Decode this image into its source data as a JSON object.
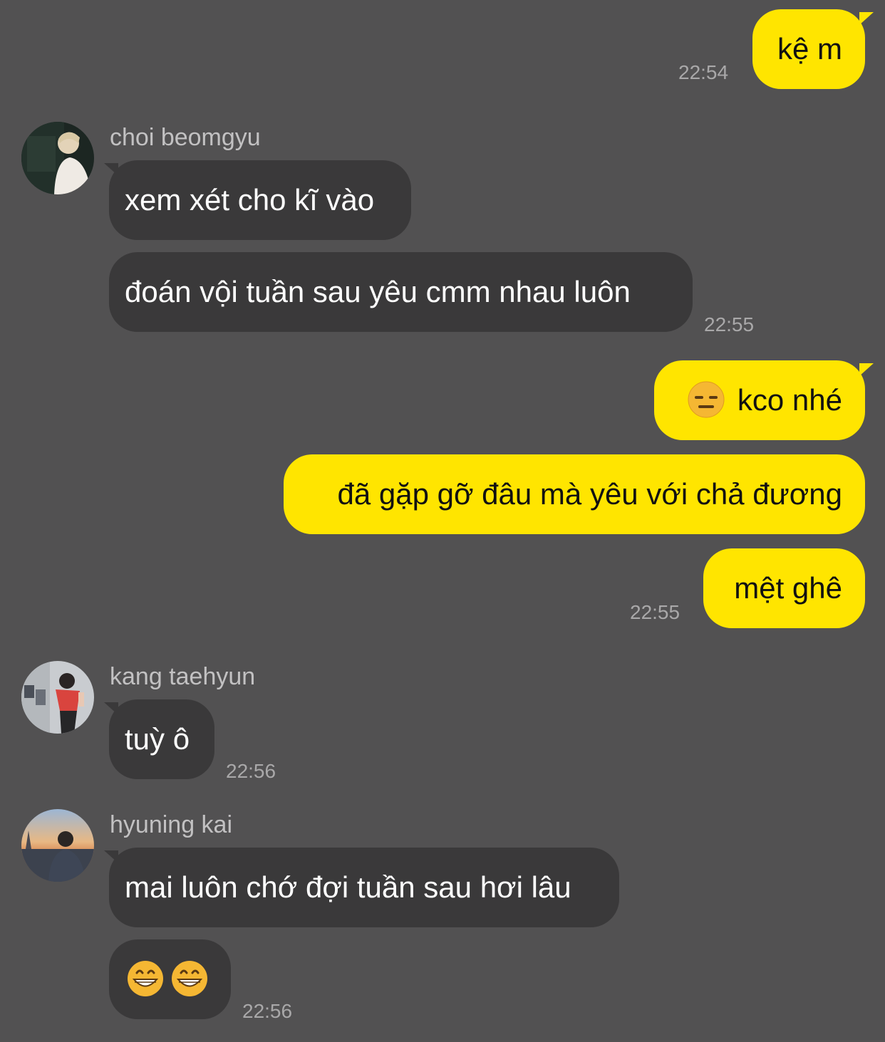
{
  "chat": {
    "messages": {
      "out_1": {
        "text": "kệ m",
        "time": "22:54"
      },
      "group_beomgyu": {
        "sender": "choi beomgyu",
        "avatar_icon": "avatar-photo-icon",
        "msg_1": "xem xét cho kĩ vào",
        "msg_2": "đoán vội tuần sau yêu cmm nhau luôn",
        "time": "22:55"
      },
      "out_group_2": {
        "msg_1_emoji": "expressionless-face-emoji",
        "msg_1": "kco nhé",
        "msg_2": "đã gặp gỡ đâu mà yêu với chả đương",
        "msg_3": "mệt ghê",
        "time": "22:55"
      },
      "group_taehyun": {
        "sender": "kang taehyun",
        "avatar_icon": "avatar-photo-icon",
        "msg_1": "tuỳ ô",
        "time": "22:56"
      },
      "group_kai": {
        "sender": "hyuning kai",
        "avatar_icon": "avatar-photo-icon",
        "msg_1": "mai luôn chớ đợi tuần sau hơi lâu",
        "msg_2_emoji": "grinning-face-emoji",
        "msg_2_emoji_count": 2,
        "time": "22:56"
      }
    }
  },
  "colors": {
    "background": "#525152",
    "incoming_bubble": "#3a393a",
    "outgoing_bubble": "#ffe500",
    "timestamp": "#a9a8a9",
    "sender_name": "#c2c1c2"
  }
}
